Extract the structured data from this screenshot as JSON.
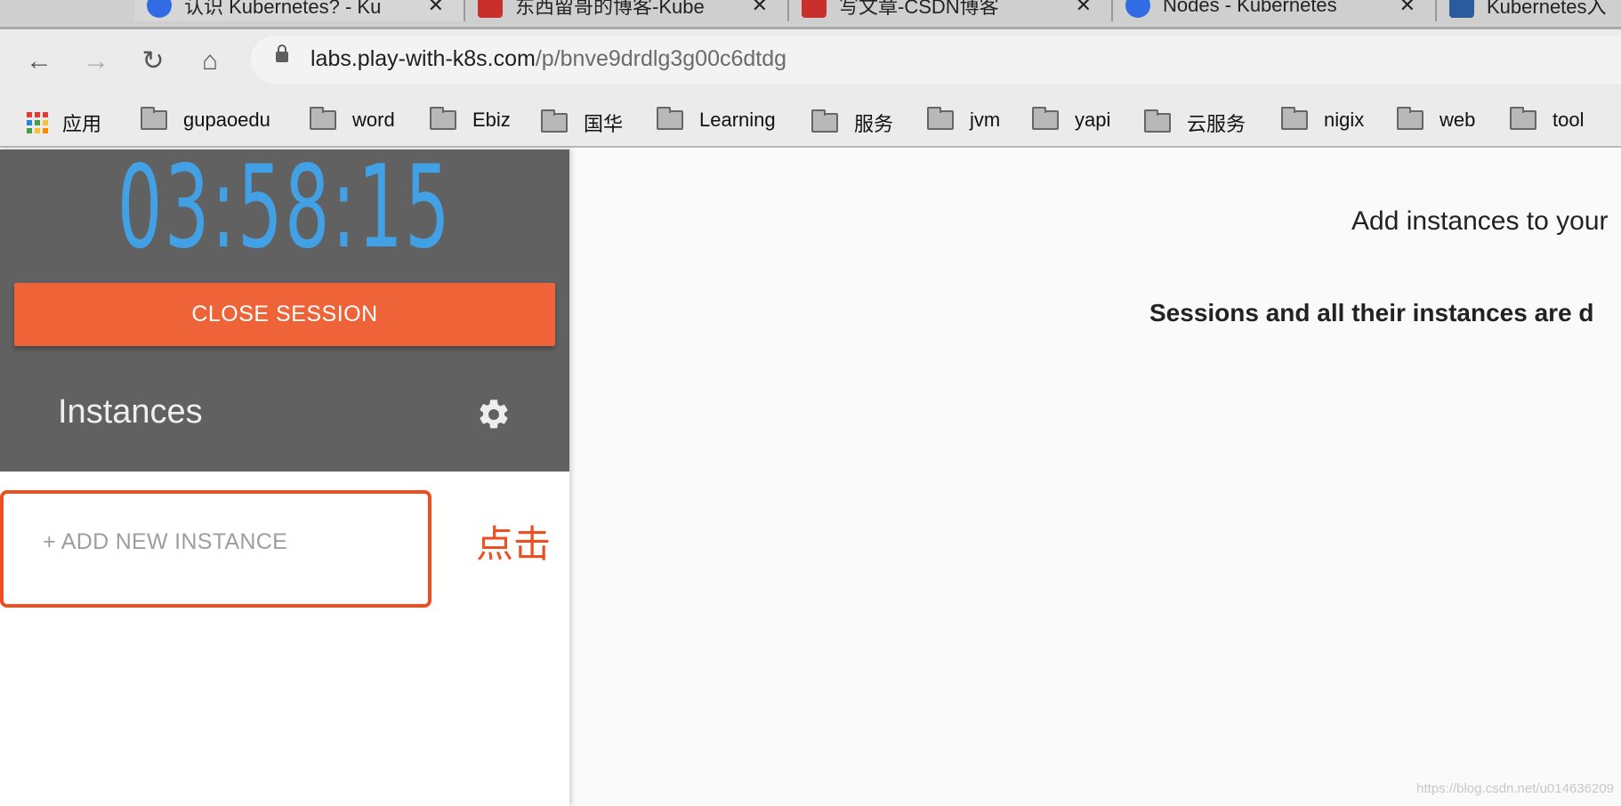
{
  "browser": {
    "tabs": [
      {
        "title": "认识 Kubernetes? - Ku",
        "favicon": "kubernetes-icon",
        "color": "#326ce5"
      },
      {
        "title": "东西留哥的博客-Kube",
        "favicon": "csdn-icon",
        "color": "#c9302c"
      },
      {
        "title": "写文章-CSDN博客",
        "favicon": "csdn-icon",
        "color": "#c9302c"
      },
      {
        "title": "Nodes - Kubernetes",
        "favicon": "kubernetes-icon",
        "color": "#326ce5"
      },
      {
        "title": "Kubernetes入",
        "favicon": "site-icon",
        "color": "#2a5b9c"
      }
    ],
    "url_host": "labs.play-with-k8s.com",
    "url_path": "/p/bnve9drdlg3g00c6dtdg",
    "bookmarks": [
      "应用",
      "gupaoedu",
      "word",
      "Ebiz",
      "国华",
      "Learning",
      "服务",
      "jvm",
      "yapi",
      "云服务",
      "nigix",
      "web",
      "tool"
    ]
  },
  "sidebar": {
    "timer": "03:58:15",
    "close_session": "CLOSE SESSION",
    "instances_title": "Instances",
    "add_instance": "+ ADD NEW INSTANCE",
    "annotation": "点击"
  },
  "main": {
    "message": "Add instances to your",
    "warning": "Sessions and all their instances are d"
  },
  "watermark": "https://blog.csdn.net/u014636209",
  "colors": {
    "accent": "#ee6338",
    "timer": "#42a0e4",
    "annotation": "#ee4f22",
    "sidebar": "#616161"
  }
}
